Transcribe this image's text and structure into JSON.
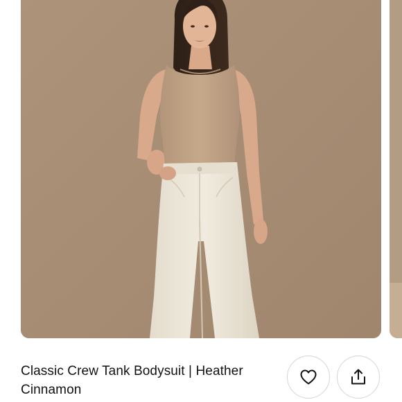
{
  "product": {
    "title": "Classic Crew Tank Bodysuit | Heather Cinnamon"
  },
  "gallery": {
    "image_alt": "Model wearing tan sleeveless crew tank bodysuit with cream high-waisted jeans",
    "background_color": "#a88e75"
  },
  "actions": {
    "favorite_icon": "heart-icon",
    "share_icon": "share-icon"
  },
  "colors": {
    "bodysuit": "#c2a484",
    "jeans": "#ece6d8",
    "text": "#111111",
    "button_border": "#d5d5d5"
  }
}
